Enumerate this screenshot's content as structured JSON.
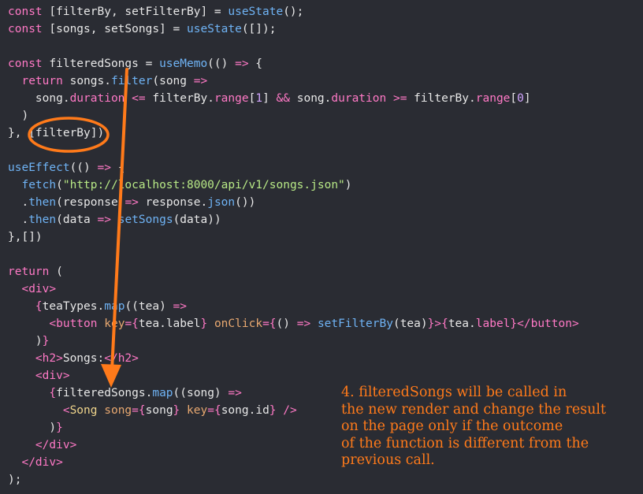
{
  "code_lines": [
    [
      [
        "kw",
        "const"
      ],
      [
        "plain",
        " [filterBy, setFilterBy] = "
      ],
      [
        "fn",
        "useState"
      ],
      [
        "plain",
        "();"
      ]
    ],
    [
      [
        "kw",
        "const"
      ],
      [
        "plain",
        " [songs, setSongs] = "
      ],
      [
        "fn",
        "useState"
      ],
      [
        "plain",
        "([]);"
      ]
    ],
    [],
    [
      [
        "kw",
        "const"
      ],
      [
        "plain",
        " filteredSongs = "
      ],
      [
        "fn",
        "useMemo"
      ],
      [
        "plain",
        "(() "
      ],
      [
        "op",
        "=>"
      ],
      [
        "plain",
        " {"
      ]
    ],
    [
      [
        "plain",
        "  "
      ],
      [
        "kw",
        "return"
      ],
      [
        "plain",
        " songs."
      ],
      [
        "fn",
        "filter"
      ],
      [
        "plain",
        "(song "
      ],
      [
        "op",
        "=>"
      ]
    ],
    [
      [
        "plain",
        "    song."
      ],
      [
        "prop",
        "duration"
      ],
      [
        "plain",
        " "
      ],
      [
        "op",
        "<="
      ],
      [
        "plain",
        " filterBy."
      ],
      [
        "prop",
        "range"
      ],
      [
        "plain",
        "["
      ],
      [
        "num",
        "1"
      ],
      [
        "plain",
        "] "
      ],
      [
        "op",
        "&&"
      ],
      [
        "plain",
        " song."
      ],
      [
        "prop",
        "duration"
      ],
      [
        "plain",
        " "
      ],
      [
        "op",
        ">="
      ],
      [
        "plain",
        " filterBy."
      ],
      [
        "prop",
        "range"
      ],
      [
        "plain",
        "["
      ],
      [
        "num",
        "0"
      ],
      [
        "plain",
        "]"
      ]
    ],
    [
      [
        "plain",
        "  )"
      ]
    ],
    [
      [
        "plain",
        "}, [filterBy]);"
      ]
    ],
    [],
    [
      [
        "fn",
        "useEffect"
      ],
      [
        "plain",
        "(() "
      ],
      [
        "op",
        "=>"
      ],
      [
        "plain",
        " {"
      ]
    ],
    [
      [
        "plain",
        "  "
      ],
      [
        "fn",
        "fetch"
      ],
      [
        "plain",
        "("
      ],
      [
        "str",
        "\"http://localhost:8000/api/v1/songs.json\""
      ],
      [
        "plain",
        ")"
      ]
    ],
    [
      [
        "plain",
        "  ."
      ],
      [
        "fn",
        "then"
      ],
      [
        "plain",
        "(response "
      ],
      [
        "op",
        "=>"
      ],
      [
        "plain",
        " response."
      ],
      [
        "fn",
        "json"
      ],
      [
        "plain",
        "())"
      ]
    ],
    [
      [
        "plain",
        "  ."
      ],
      [
        "fn",
        "then"
      ],
      [
        "plain",
        "(data "
      ],
      [
        "op",
        "=>"
      ],
      [
        "plain",
        " "
      ],
      [
        "fn",
        "setSongs"
      ],
      [
        "plain",
        "(data))"
      ]
    ],
    [
      [
        "plain",
        "},[])"
      ]
    ],
    [],
    [
      [
        "kw",
        "return"
      ],
      [
        "plain",
        " ("
      ]
    ],
    [
      [
        "plain",
        "  "
      ],
      [
        "tag",
        "<div>"
      ]
    ],
    [
      [
        "plain",
        "    "
      ],
      [
        "brace",
        "{"
      ],
      [
        "plain",
        "teaTypes."
      ],
      [
        "fn",
        "map"
      ],
      [
        "plain",
        "((tea) "
      ],
      [
        "op",
        "=>"
      ]
    ],
    [
      [
        "plain",
        "      "
      ],
      [
        "tag",
        "<button"
      ],
      [
        "plain",
        " "
      ],
      [
        "attr",
        "key"
      ],
      [
        "op",
        "="
      ],
      [
        "brace",
        "{"
      ],
      [
        "plain",
        "tea.label"
      ],
      [
        "brace",
        "}"
      ],
      [
        "plain",
        " "
      ],
      [
        "attr",
        "onClick"
      ],
      [
        "op",
        "="
      ],
      [
        "brace",
        "{"
      ],
      [
        "plain",
        "() "
      ],
      [
        "op",
        "=>"
      ],
      [
        "plain",
        " "
      ],
      [
        "fn",
        "setFilterBy"
      ],
      [
        "plain",
        "(tea)"
      ],
      [
        "brace",
        "}"
      ],
      [
        "tag",
        ">"
      ],
      [
        "brace",
        "{"
      ],
      [
        "plain",
        "tea."
      ],
      [
        "prop",
        "label"
      ],
      [
        "brace",
        "}"
      ],
      [
        "tag",
        "</button>"
      ]
    ],
    [
      [
        "plain",
        "    )"
      ],
      [
        "brace",
        "}"
      ]
    ],
    [
      [
        "plain",
        "    "
      ],
      [
        "tag",
        "<h2>"
      ],
      [
        "plain",
        "Songs:"
      ],
      [
        "tag",
        "</h2>"
      ]
    ],
    [
      [
        "plain",
        "    "
      ],
      [
        "tag",
        "<div>"
      ]
    ],
    [
      [
        "plain",
        "      "
      ],
      [
        "brace",
        "{"
      ],
      [
        "plain",
        "filteredSongs."
      ],
      [
        "fn",
        "map"
      ],
      [
        "plain",
        "((song) "
      ],
      [
        "op",
        "=>"
      ]
    ],
    [
      [
        "plain",
        "        "
      ],
      [
        "tag",
        "<"
      ],
      [
        "comp",
        "Song"
      ],
      [
        "plain",
        " "
      ],
      [
        "attr",
        "song"
      ],
      [
        "op",
        "="
      ],
      [
        "brace",
        "{"
      ],
      [
        "plain",
        "song"
      ],
      [
        "brace",
        "}"
      ],
      [
        "plain",
        " "
      ],
      [
        "attr",
        "key"
      ],
      [
        "op",
        "="
      ],
      [
        "brace",
        "{"
      ],
      [
        "plain",
        "song.id"
      ],
      [
        "brace",
        "}"
      ],
      [
        "plain",
        " "
      ],
      [
        "tag",
        "/>"
      ]
    ],
    [
      [
        "plain",
        "      )"
      ],
      [
        "brace",
        "}"
      ]
    ],
    [
      [
        "plain",
        "    "
      ],
      [
        "tag",
        "</div>"
      ]
    ],
    [
      [
        "plain",
        "  "
      ],
      [
        "tag",
        "</div>"
      ]
    ],
    [
      [
        "plain",
        ");"
      ]
    ]
  ],
  "annotation": {
    "text": "4. filteredSongs will be called in\nthe new render and change the result\non the page only if the outcome\nof the function is different from the\nprevious call.",
    "color": "#ff7a1a"
  },
  "highlight": {
    "label": "[filterBy]",
    "shape": "ellipse",
    "color": "#ff7a1a"
  },
  "arrow": {
    "color": "#ff7a1a"
  }
}
